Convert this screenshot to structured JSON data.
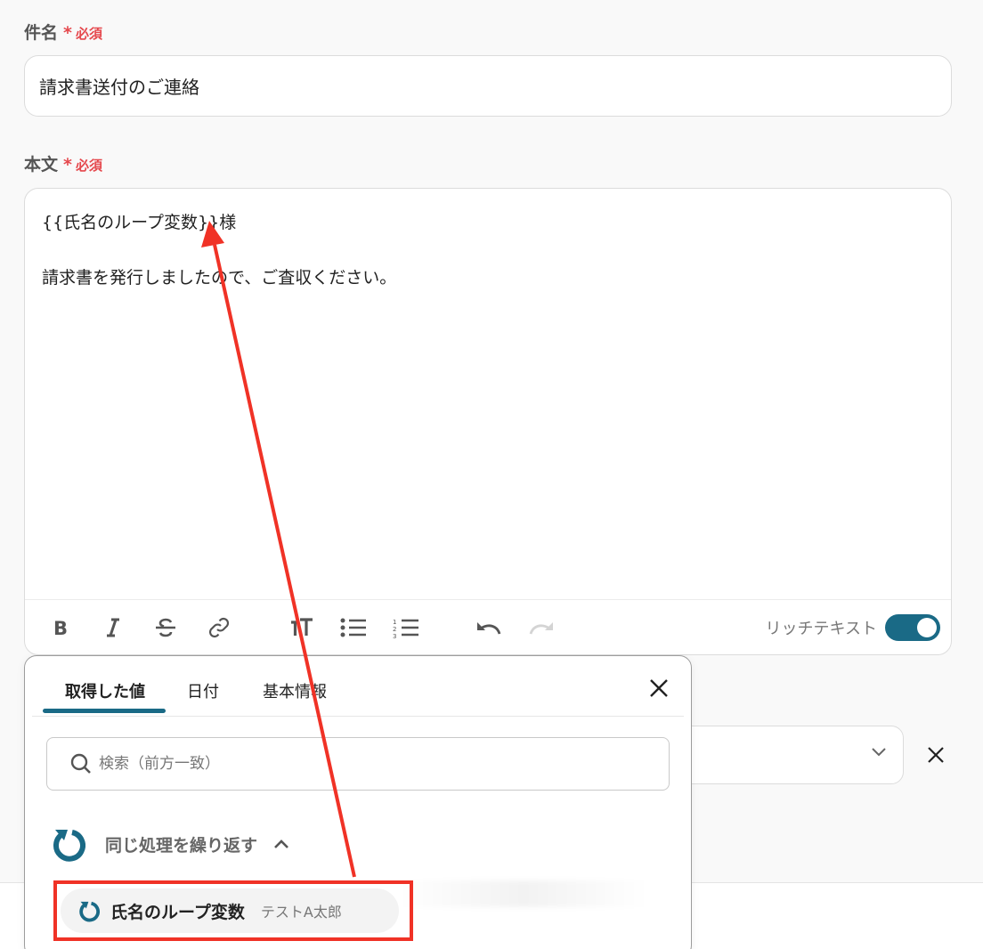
{
  "subject": {
    "label": "件名",
    "required_star": "*",
    "required_text": "必須",
    "value": "請求書送付のご連絡"
  },
  "body": {
    "label": "本文",
    "required_star": "*",
    "required_text": "必須",
    "line1": "{{氏名のループ変数}}様",
    "line2": "請求書を発行しましたので、ご査収ください。"
  },
  "toolbar": {
    "buttons": [
      "bold",
      "italic",
      "strikethrough",
      "link",
      "text-size",
      "bullet-list",
      "numbered-list",
      "undo",
      "redo"
    ],
    "rich_text_label": "リッチテキスト",
    "rich_text_enabled": true
  },
  "popup": {
    "tabs": [
      {
        "label": "取得した値",
        "active": true
      },
      {
        "label": "日付",
        "active": false
      },
      {
        "label": "基本情報",
        "active": false
      }
    ],
    "search_placeholder": "検索（前方一致）",
    "group": {
      "label": "同じ処理を繰り返す",
      "expanded": true,
      "icon": "loop-icon"
    },
    "items": [
      {
        "name": "氏名のループ変数",
        "value": "テストA太郎",
        "icon": "loop-icon"
      }
    ]
  },
  "colors": {
    "accent": "#1a6a86",
    "required": "#e5484d",
    "annotation": "#f03226"
  }
}
